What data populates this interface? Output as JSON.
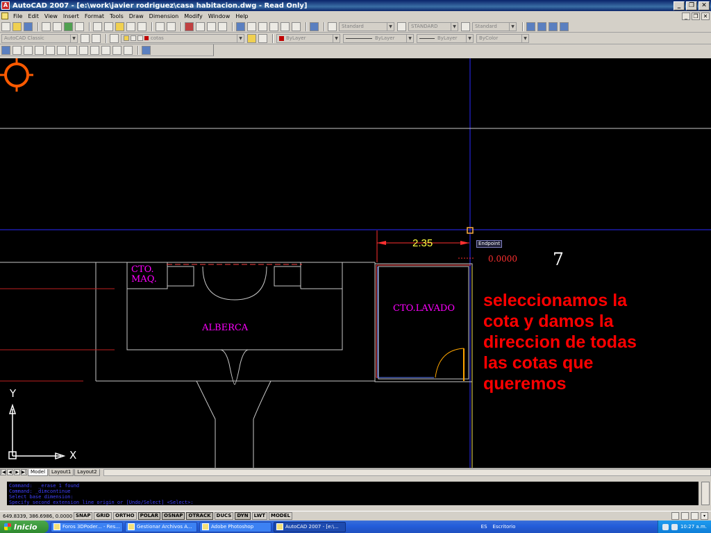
{
  "window": {
    "title": "AutoCAD 2007 - [e:\\work\\javier rodriguez\\casa habitacion.dwg - Read Only]",
    "app_icon": "autocad-icon"
  },
  "menu": {
    "items": [
      "File",
      "Edit",
      "View",
      "Insert",
      "Format",
      "Tools",
      "Draw",
      "Dimension",
      "Modify",
      "Window",
      "Help"
    ]
  },
  "toolbars": {
    "text_style": "Standard",
    "dim_style": "STANDARD",
    "table_style": "Standard",
    "workspace": "AutoCAD Classic",
    "layer": "cotas",
    "color": "ByLayer",
    "linetype": "ByLayer",
    "lineweight": "ByLayer",
    "plotstyle": "ByColor"
  },
  "drawing": {
    "rooms": {
      "cto_maq": "CTO.\nMAQ.",
      "alberca": "ALBERCA",
      "cto_lavado": "CTO.LAVADO"
    },
    "dimension_value": "2.35",
    "dimension_preview": "0.0000",
    "snap_tooltip": "Endpoint",
    "ucs_y": "Y",
    "ucs_x": "X",
    "colors": {
      "background": "#000000",
      "room_text": "#ff00ff",
      "dimension": "#ffff40",
      "annotation": "#ff0000",
      "crosshair": "#2a2aff"
    }
  },
  "annotation": {
    "step": "7",
    "text": [
      "seleccionamos la",
      "cota y damos la",
      "direccion de todas",
      "las cotas que",
      "queremos"
    ]
  },
  "layout_tabs": {
    "tabs": [
      "Model",
      "Layout1",
      "Layout2"
    ],
    "active": "Model"
  },
  "command": {
    "history": [
      "Command:  _erase 1 found",
      "Command: _dimcontinue",
      "Select base dimension:",
      "Specify second extension line origin or [Undo/Select] <Select>:"
    ]
  },
  "status": {
    "coords": "649.8339, 386.6986, 0.0000",
    "toggles": [
      "SNAP",
      "GRID",
      "ORTHO",
      "POLAR",
      "OSNAP",
      "OTRACK",
      "DUCS",
      "DYN",
      "LWT",
      "MODEL"
    ]
  },
  "taskbar": {
    "start": "Inicio",
    "tasks": [
      "Foros 3DPoder... - Res...",
      "Gestionar Archivos A...",
      "Adobe Photoshop",
      "AutoCAD 2007 - [e:\\..."
    ],
    "active_task": 3,
    "language": "ES",
    "desktop": "Escritorio",
    "clock": "10:27 a.m."
  }
}
